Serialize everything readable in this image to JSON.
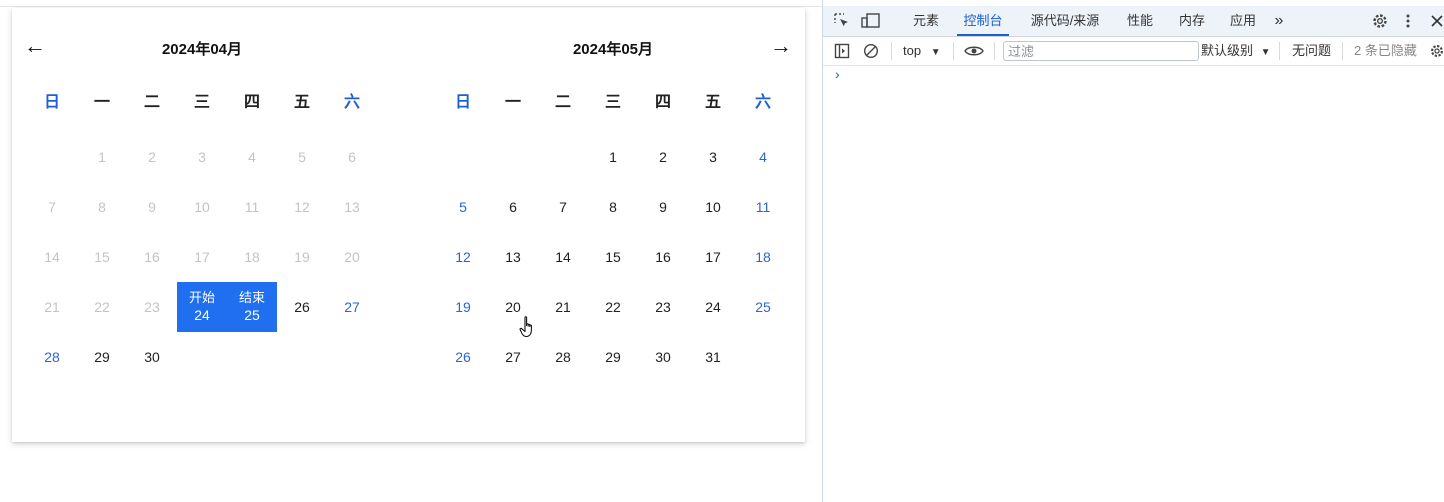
{
  "calendar": {
    "prev_arrow": "←",
    "next_arrow": "→",
    "months": [
      {
        "title": "2024年04月",
        "weekdays": [
          "日",
          "一",
          "二",
          "三",
          "四",
          "五",
          "六"
        ],
        "days": [
          [
            "",
            "1",
            "2",
            "3",
            "4",
            "5",
            "6"
          ],
          [
            "7",
            "8",
            "9",
            "10",
            "11",
            "12",
            "13"
          ],
          [
            "14",
            "15",
            "16",
            "17",
            "18",
            "19",
            "20"
          ],
          [
            "21",
            "22",
            "23",
            "24",
            "25",
            "26",
            "27"
          ],
          [
            "28",
            "29",
            "30",
            "",
            "",
            "",
            ""
          ]
        ],
        "disabled_until": 23,
        "range_start_label": "开始",
        "range_end_label": "结束",
        "range_start_day": "24",
        "range_end_day": "25"
      },
      {
        "title": "2024年05月",
        "weekdays": [
          "日",
          "一",
          "二",
          "三",
          "四",
          "五",
          "六"
        ],
        "days": [
          [
            "",
            "",
            "",
            "1",
            "2",
            "3",
            "4"
          ],
          [
            "5",
            "6",
            "7",
            "8",
            "9",
            "10",
            "11"
          ],
          [
            "12",
            "13",
            "14",
            "15",
            "16",
            "17",
            "18"
          ],
          [
            "19",
            "20",
            "21",
            "22",
            "23",
            "24",
            "25"
          ],
          [
            "26",
            "27",
            "28",
            "29",
            "30",
            "31",
            ""
          ]
        ]
      }
    ],
    "colors": {
      "selected_bg": "#1f6ff0",
      "weekend": "#2a66d2",
      "disabled": "#c4c4c4"
    }
  },
  "devtools": {
    "tabs": [
      "元素",
      "控制台",
      "源代码/来源",
      "性能",
      "内存",
      "应用"
    ],
    "active_tab": "控制台",
    "more": "»",
    "toolbar": {
      "context": "top",
      "filter_placeholder": "过滤",
      "levels": "默认级别",
      "issues": "无问题",
      "hidden": "2 条已隐藏"
    },
    "prompt": "›"
  }
}
